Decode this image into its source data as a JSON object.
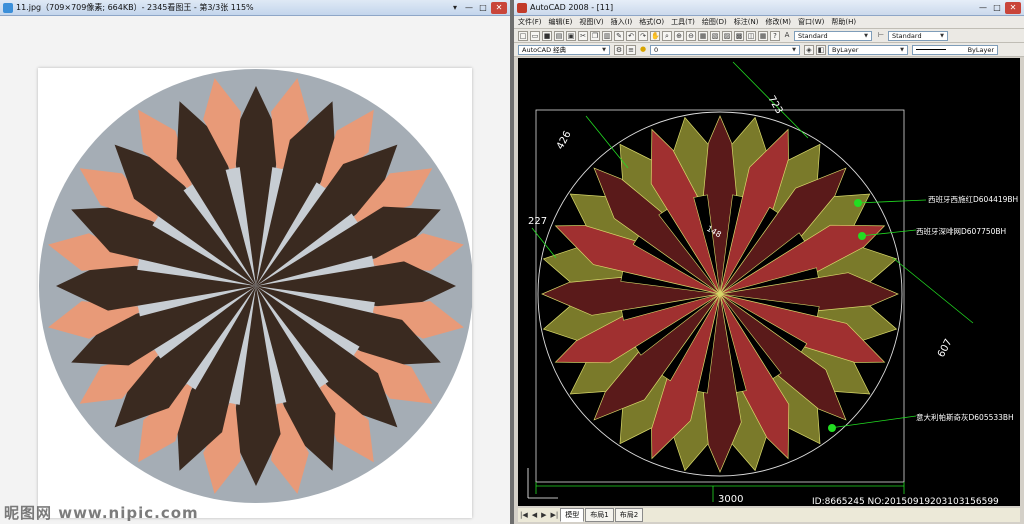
{
  "viewer": {
    "title": "11.jpg（709×709像素; 664KB）- 2345看图王 - 第3/3张 115%",
    "controls": {
      "menu": "▾",
      "minimize": "—",
      "maximize": "□",
      "close": "✕"
    },
    "watermark": "昵图网 www.nipic.com"
  },
  "cad": {
    "title": "AutoCAD 2008 - [11]",
    "controls": {
      "minimize": "—",
      "maximize": "□",
      "close": "✕"
    },
    "menu": [
      "文件(F)",
      "编辑(E)",
      "视图(V)",
      "插入(I)",
      "格式(O)",
      "工具(T)",
      "绘图(D)",
      "标注(N)",
      "修改(M)",
      "窗口(W)",
      "帮助(H)"
    ],
    "toolbar": {
      "text_style": "Standard",
      "dim_style": "Standard",
      "workspace": "AutoCAD 经典",
      "layer": "0",
      "color": "ByLayer",
      "linetype": "ByLayer"
    },
    "dimensions": [
      "723",
      "426",
      "227",
      "148",
      "607",
      "3000"
    ],
    "material_labels": [
      "西班牙西施红D604419BH",
      "西班牙深啡网D607750BH",
      "意大利帕斯奇灰D605533BH"
    ],
    "id_text": "ID:8665245 NO:20150919203103156599",
    "tabs": [
      "模型",
      "布局1",
      "布局2"
    ],
    "tab_nav": [
      "|◀",
      "◀",
      "▶",
      "▶|"
    ]
  },
  "colors": {
    "salmon": "#e89a78",
    "dark_marble": "#3a2a20",
    "grey_marble": "#a5adb5",
    "cad_yellow": "#d8d86a",
    "cad_red": "#a03030",
    "cad_green": "#22dd22"
  }
}
